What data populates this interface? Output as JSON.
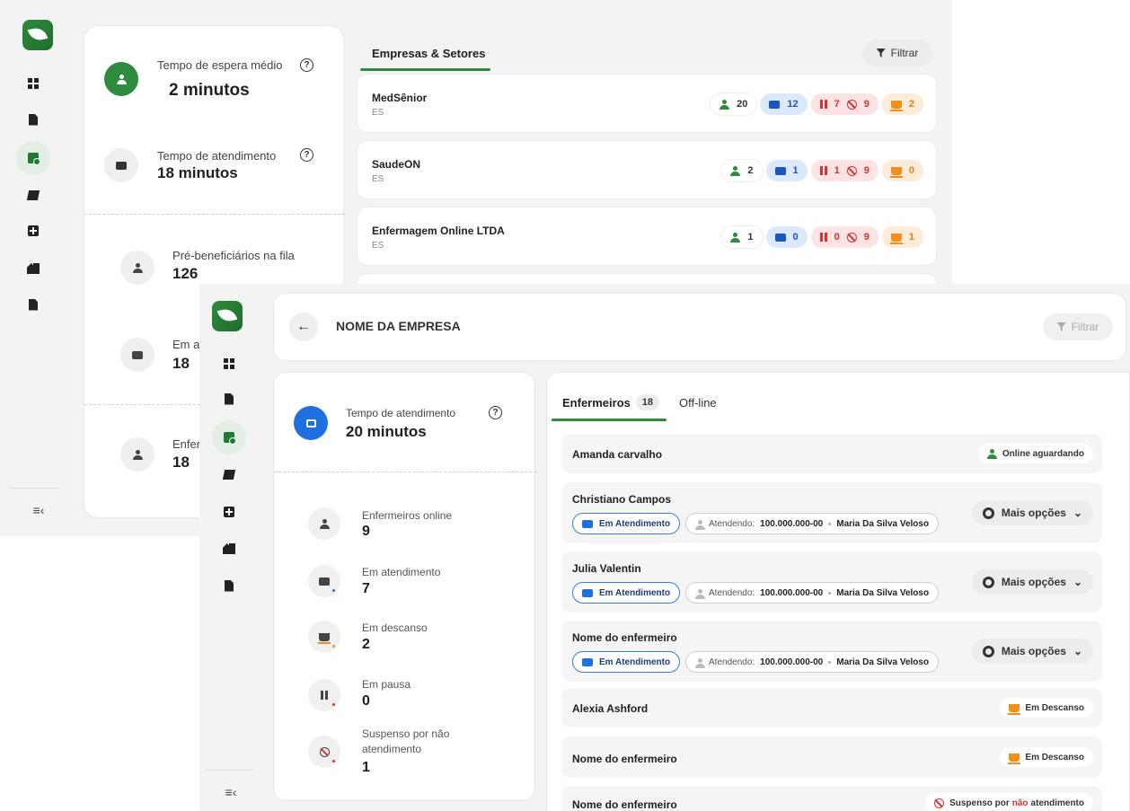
{
  "back": {
    "stats": {
      "wait_label": "Tempo de espera médio",
      "wait_value": "2 minutos",
      "service_label": "Tempo de atendimento",
      "service_value": "18 minutos",
      "queue_label": "Pré-beneficiários na fila",
      "queue_value": "126",
      "in_service_label": "Em at",
      "in_service_value": "18",
      "nurses_label": "Enferi",
      "nurses_value": "18",
      "help_icon": "?"
    },
    "tab_label": "Empresas & Setores",
    "filter_label": "Filtrar",
    "companies": [
      {
        "name": "MedSênior",
        "state": "ES",
        "online": "20",
        "in_service": "12",
        "paused": "7",
        "suspended": "9",
        "resting": "2"
      },
      {
        "name": "SaudeON",
        "state": "ES",
        "online": "2",
        "in_service": "1",
        "paused": "1",
        "suspended": "9",
        "resting": "0"
      },
      {
        "name": "Enfermagem Online LTDA",
        "state": "ES",
        "online": "1",
        "in_service": "0",
        "paused": "0",
        "suspended": "9",
        "resting": "1"
      }
    ]
  },
  "front": {
    "title": "NOME DA EMPRESA",
    "filter_label": "Filtrar",
    "service_time_label": "Tempo de atendimento",
    "service_time_value": "20 minutos",
    "stats": [
      {
        "label": "Enfermeiros online",
        "value": "9"
      },
      {
        "label": "Em atendimento",
        "value": "7"
      },
      {
        "label": "Em descanso",
        "value": "2"
      },
      {
        "label": "Em pausa",
        "value": "0"
      },
      {
        "label": "Suspenso por não atendimento",
        "value": "1"
      }
    ],
    "tabs": [
      {
        "label": "Enfermeiros",
        "count": "18"
      },
      {
        "label": "Off-line"
      }
    ],
    "nurses": [
      {
        "name": "Amanda carvalho",
        "status": "Online aguardando"
      },
      {
        "name": "Christiano Campos",
        "chip": "Em Atendimento",
        "attending_label": "Atendendo:",
        "attending_id": "100.000.000-00",
        "attending_name": "Maria Da Silva Veloso",
        "more": "Mais opções"
      },
      {
        "name": "Julia Valentin",
        "chip": "Em Atendimento",
        "attending_label": "Atendendo:",
        "attending_id": "100.000.000-00",
        "attending_name": "Maria Da Silva Veloso",
        "more": "Mais opções"
      },
      {
        "name": "Nome do enfermeiro",
        "chip": "Em Atendimento",
        "attending_label": "Atendendo:",
        "attending_id": "100.000.000-00",
        "attending_name": "Maria Da Silva Veloso",
        "more": "Mais opções"
      },
      {
        "name": "Alexia Ashford",
        "status": "Em Descanso"
      },
      {
        "name": "Nome do enfermeiro",
        "status": "Em Descanso"
      },
      {
        "name": "Nome do enfermeiro",
        "status_pre": "Suspenso por",
        "status_em": "não",
        "status_post": "atendimento"
      }
    ]
  },
  "colors": {
    "brand_green": "#2e8b3e",
    "accent_blue": "#1f6fe0",
    "danger_red": "#d93030",
    "rest_orange": "#f0901a"
  }
}
